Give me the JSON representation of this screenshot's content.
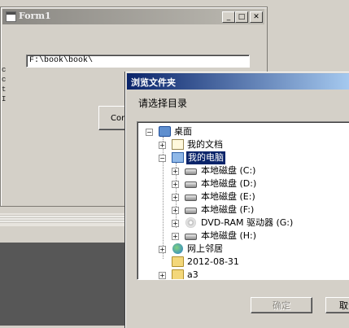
{
  "form1": {
    "title": "Form1",
    "path_value": "F:\\book\\book\\",
    "side_text": [
      "c",
      "c",
      "t",
      "I"
    ],
    "command_label": "Comm",
    "minimize_glyph": "_",
    "maximize_glyph": "□",
    "close_glyph": "✕"
  },
  "dialog": {
    "title": "浏览文件夹",
    "prompt": "请选择目录",
    "tree": [
      {
        "label": "桌面",
        "icon": "desktop-icon",
        "expander": "minus"
      },
      {
        "label": "我的文档",
        "icon": "my-documents-icon",
        "expander": "plus"
      },
      {
        "label": "我的电脑",
        "icon": "my-computer-icon",
        "expander": "minus",
        "selected": true
      },
      {
        "label": "本地磁盘 (C:)",
        "icon": "hard-drive-icon",
        "expander": "plus"
      },
      {
        "label": "本地磁盘 (D:)",
        "icon": "hard-drive-icon",
        "expander": "plus"
      },
      {
        "label": "本地磁盘 (E:)",
        "icon": "hard-drive-icon",
        "expander": "plus"
      },
      {
        "label": "本地磁盘 (F:)",
        "icon": "hard-drive-icon",
        "expander": "plus"
      },
      {
        "label": "DVD-RAM 驱动器 (G:)",
        "icon": "dvd-drive-icon",
        "expander": "plus"
      },
      {
        "label": "本地磁盘 (H:)",
        "icon": "hard-drive-icon",
        "expander": "plus"
      },
      {
        "label": "网上邻居",
        "icon": "network-icon",
        "expander": "plus"
      },
      {
        "label": "2012-08-31",
        "icon": "folder-icon",
        "expander": "none"
      },
      {
        "label": "a3",
        "icon": "folder-icon",
        "expander": "plus"
      }
    ],
    "ok_label": "确定",
    "cancel_label": "取消"
  },
  "colors": {
    "dialog_title_start": "#0a246a",
    "dialog_title_end": "#a6caf0",
    "selection": "#0a246a"
  }
}
